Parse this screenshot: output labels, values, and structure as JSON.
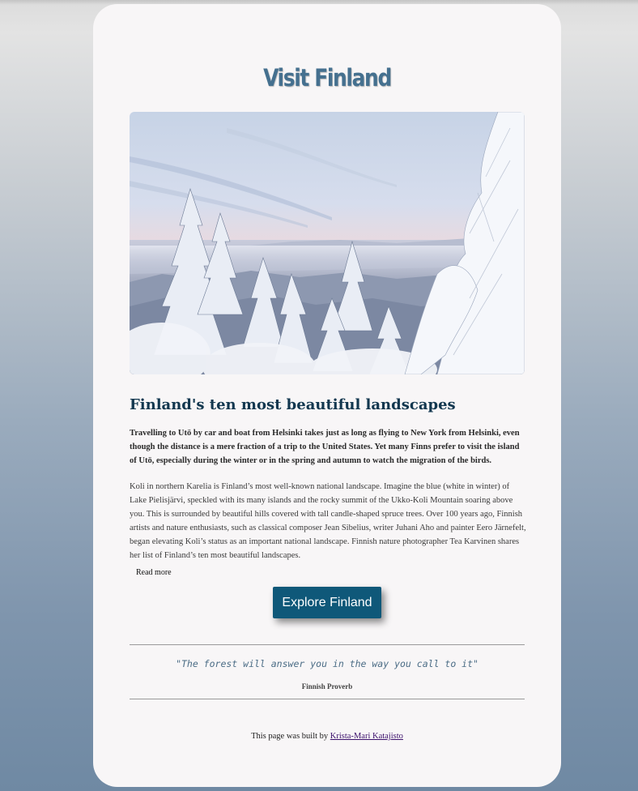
{
  "page": {
    "title": "Visit Finland"
  },
  "hero_image": {
    "description_icon": "snowy-forest-landscape-image"
  },
  "article": {
    "heading": "Finland's ten most beautiful landscapes",
    "lead": "Travelling to Utö by car and boat from Helsinki takes just as long as flying to New York from Helsinki, even though the distance is a mere fraction of a trip to the United States. Yet many Finns prefer to visit the island of Utö, especially during the winter or in the spring and autumn to watch the migration of the birds.",
    "body": "Koli in northern Karelia is Finland’s most well-known national landscape. Imagine the blue (white in winter) of Lake Pielisjärvi, speckled with its many islands and the rocky summit of the Ukko-Koli Mountain soaring above you. This is surrounded by beautiful hills covered with tall candle-shaped spruce trees. Over 100 years ago, Finnish artists and nature enthusiasts, such as classical composer Jean Sibelius, writer Juhani Aho and painter Eero Järnefelt, began elevating Koli’s status as an important national landscape. Finnish nature photographer Tea Karvinen shares her list of Finland’s ten most beautiful landscapes.",
    "read_more_label": "Read more"
  },
  "cta": {
    "label": "Explore Finland"
  },
  "quote": {
    "text": "\"The forest will answer you in the way you call to it\"",
    "source": "Finnish Proverb"
  },
  "footer": {
    "prefix": "This page was built by ",
    "author": "Krista-Mari Katajisto"
  },
  "colors": {
    "title": "#45708f",
    "heading": "#12374f",
    "button": "#0f5879",
    "quote": "#4c6d86",
    "card": "#f8f6f7"
  }
}
